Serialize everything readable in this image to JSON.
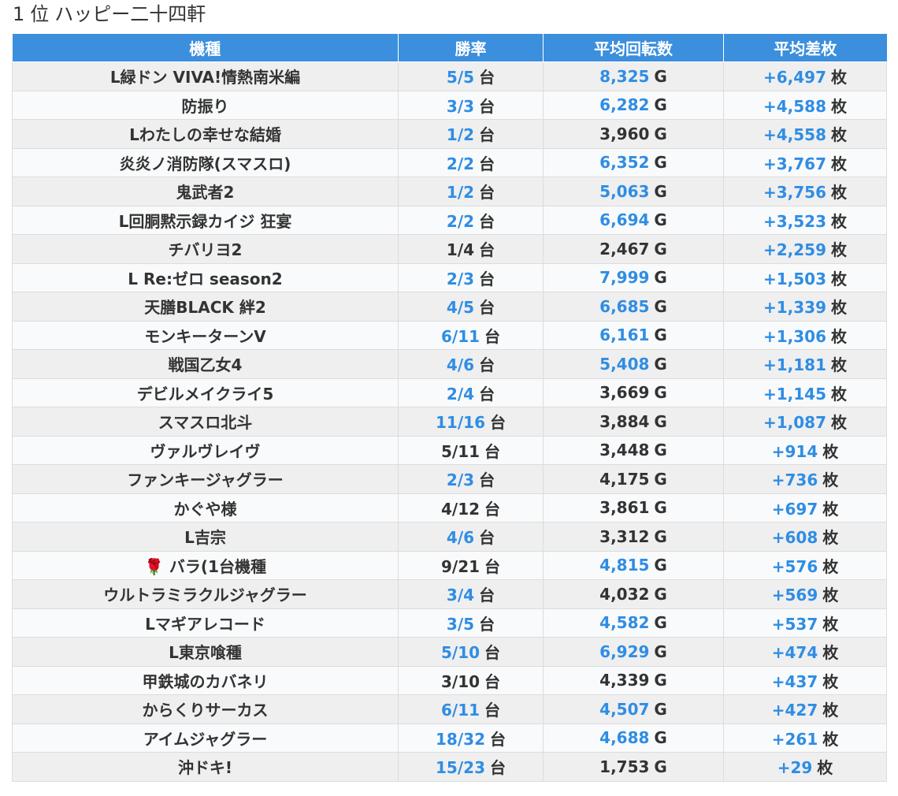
{
  "title": {
    "rank": "1",
    "rank_unit": "位",
    "store": "ハッピー二十四軒"
  },
  "colors": {
    "header_bg": "#3b8fdc",
    "highlight": "#2f8de4",
    "row_odd": "#efefef",
    "row_even": "#f9fafb"
  },
  "table": {
    "headers": [
      "機種",
      "勝率",
      "平均回転数",
      "平均差枚"
    ],
    "units": {
      "win": "台",
      "games": "G",
      "diff": "枚"
    },
    "rows": [
      {
        "model": "L緑ドン VIVA!情熱南米編",
        "win": "5/5",
        "games": "8,325",
        "diff": "+6,497",
        "win_hl": true,
        "games_hl": true,
        "diff_hl": true
      },
      {
        "model": "防振り",
        "win": "3/3",
        "games": "6,282",
        "diff": "+4,588",
        "win_hl": true,
        "games_hl": true,
        "diff_hl": true
      },
      {
        "model": "Lわたしの幸せな結婚",
        "win": "1/2",
        "games": "3,960",
        "diff": "+4,558",
        "win_hl": true,
        "games_hl": false,
        "diff_hl": true
      },
      {
        "model": "炎炎ノ消防隊(スマスロ)",
        "win": "2/2",
        "games": "6,352",
        "diff": "+3,767",
        "win_hl": true,
        "games_hl": true,
        "diff_hl": true
      },
      {
        "model": "鬼武者2",
        "win": "1/2",
        "games": "5,063",
        "diff": "+3,756",
        "win_hl": true,
        "games_hl": true,
        "diff_hl": true
      },
      {
        "model": "L回胴黙示録カイジ 狂宴",
        "win": "2/2",
        "games": "6,694",
        "diff": "+3,523",
        "win_hl": true,
        "games_hl": true,
        "diff_hl": true
      },
      {
        "model": "チバリヨ2",
        "win": "1/4",
        "games": "2,467",
        "diff": "+2,259",
        "win_hl": false,
        "games_hl": false,
        "diff_hl": true
      },
      {
        "model": "L Re:ゼロ season2",
        "win": "2/3",
        "games": "7,999",
        "diff": "+1,503",
        "win_hl": true,
        "games_hl": true,
        "diff_hl": true
      },
      {
        "model": "天膳BLACK 絆2",
        "win": "4/5",
        "games": "6,685",
        "diff": "+1,339",
        "win_hl": true,
        "games_hl": true,
        "diff_hl": true
      },
      {
        "model": "モンキーターンV",
        "win": "6/11",
        "games": "6,161",
        "diff": "+1,306",
        "win_hl": true,
        "games_hl": true,
        "diff_hl": true
      },
      {
        "model": "戦国乙女4",
        "win": "4/6",
        "games": "5,408",
        "diff": "+1,181",
        "win_hl": true,
        "games_hl": true,
        "diff_hl": true
      },
      {
        "model": "デビルメイクライ5",
        "win": "2/4",
        "games": "3,669",
        "diff": "+1,145",
        "win_hl": true,
        "games_hl": false,
        "diff_hl": true
      },
      {
        "model": "スマスロ北斗",
        "win": "11/16",
        "games": "3,884",
        "diff": "+1,087",
        "win_hl": true,
        "games_hl": false,
        "diff_hl": true
      },
      {
        "model": "ヴァルヴレイヴ",
        "win": "5/11",
        "games": "3,448",
        "diff": "+914",
        "win_hl": false,
        "games_hl": false,
        "diff_hl": true
      },
      {
        "model": "ファンキージャグラー",
        "win": "2/3",
        "games": "4,175",
        "diff": "+736",
        "win_hl": true,
        "games_hl": false,
        "diff_hl": true
      },
      {
        "model": "かぐや様",
        "win": "4/12",
        "games": "3,861",
        "diff": "+697",
        "win_hl": false,
        "games_hl": false,
        "diff_hl": true
      },
      {
        "model": "L吉宗",
        "win": "4/6",
        "games": "3,312",
        "diff": "+608",
        "win_hl": true,
        "games_hl": false,
        "diff_hl": true
      },
      {
        "model": "🌹 バラ(1台機種",
        "win": "9/21",
        "games": "4,815",
        "diff": "+576",
        "win_hl": false,
        "games_hl": true,
        "diff_hl": true
      },
      {
        "model": "ウルトラミラクルジャグラー",
        "win": "3/4",
        "games": "4,032",
        "diff": "+569",
        "win_hl": true,
        "games_hl": false,
        "diff_hl": true
      },
      {
        "model": "Lマギアレコード",
        "win": "3/5",
        "games": "4,582",
        "diff": "+537",
        "win_hl": true,
        "games_hl": true,
        "diff_hl": true
      },
      {
        "model": "L東京喰種",
        "win": "5/10",
        "games": "6,929",
        "diff": "+474",
        "win_hl": true,
        "games_hl": true,
        "diff_hl": true
      },
      {
        "model": "甲鉄城のカバネリ",
        "win": "3/10",
        "games": "4,339",
        "diff": "+437",
        "win_hl": false,
        "games_hl": false,
        "diff_hl": true
      },
      {
        "model": "からくりサーカス",
        "win": "6/11",
        "games": "4,507",
        "diff": "+427",
        "win_hl": true,
        "games_hl": true,
        "diff_hl": true
      },
      {
        "model": "アイムジャグラー",
        "win": "18/32",
        "games": "4,688",
        "diff": "+261",
        "win_hl": true,
        "games_hl": true,
        "diff_hl": true
      },
      {
        "model": "沖ドキ!",
        "win": "15/23",
        "games": "1,753",
        "diff": "+29",
        "win_hl": true,
        "games_hl": false,
        "diff_hl": true
      }
    ]
  }
}
